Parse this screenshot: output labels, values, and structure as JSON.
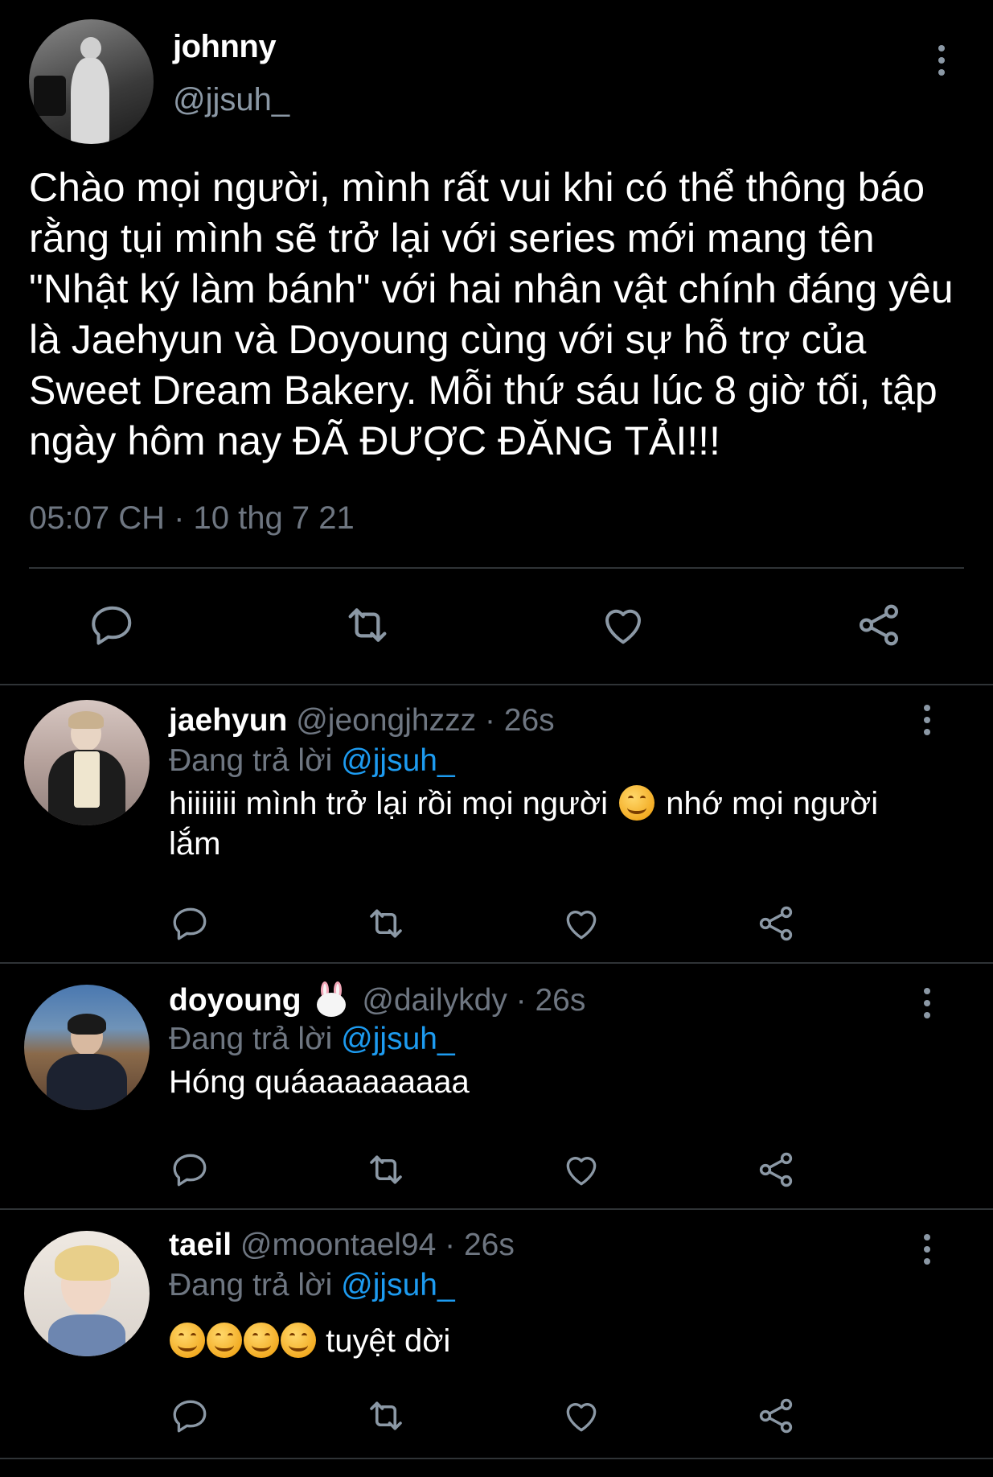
{
  "main_tweet": {
    "name": "johnny",
    "handle": "@jjsuh_",
    "text": "Chào mọi người, mình rất vui khi có thể thông báo rằng tụi mình sẽ trở lại với series mới mang tên \"Nhật ký làm bánh\" với hai nhân vật chính đáng yêu là Jaehyun và Doyoung cùng với sự hỗ trợ của Sweet Dream Bakery. Mỗi thứ sáu lúc 8 giờ tối, tập ngày hôm nay ĐÃ ĐƯỢC ĐĂNG TẢI!!!",
    "timestamp": "05:07 CH · 10 thg 7 21"
  },
  "replies": [
    {
      "name": "jaehyun",
      "handle": "@jeongjhzzz",
      "time": "· 26s",
      "replying_label": "Đang trả lời",
      "replying_to": "@jjsuh_",
      "text_before": "hiiiiiii mình trở lại rồi mọi người",
      "text_after": "nhớ mọi người lắm"
    },
    {
      "name": "doyoung",
      "handle": "@dailykdy",
      "time": "· 26s",
      "replying_label": "Đang trả lời",
      "replying_to": "@jjsuh_",
      "text": "Hóng quáaaaaaaaaa"
    },
    {
      "name": "taeil",
      "handle": "@moontael94",
      "time": "· 26s",
      "replying_label": "Đang trả lời",
      "replying_to": "@jjsuh_",
      "text": "tuyệt dời"
    }
  ],
  "colors": {
    "background": "#000000",
    "text": "#ffffff",
    "secondary": "#6e7681",
    "mention": "#1d9bf0",
    "divider": "#2f3336"
  },
  "icons": [
    "more-vertical-icon",
    "reply-icon",
    "retweet-icon",
    "like-icon",
    "share-icon",
    "smile-emoji",
    "bunny-emoji"
  ]
}
